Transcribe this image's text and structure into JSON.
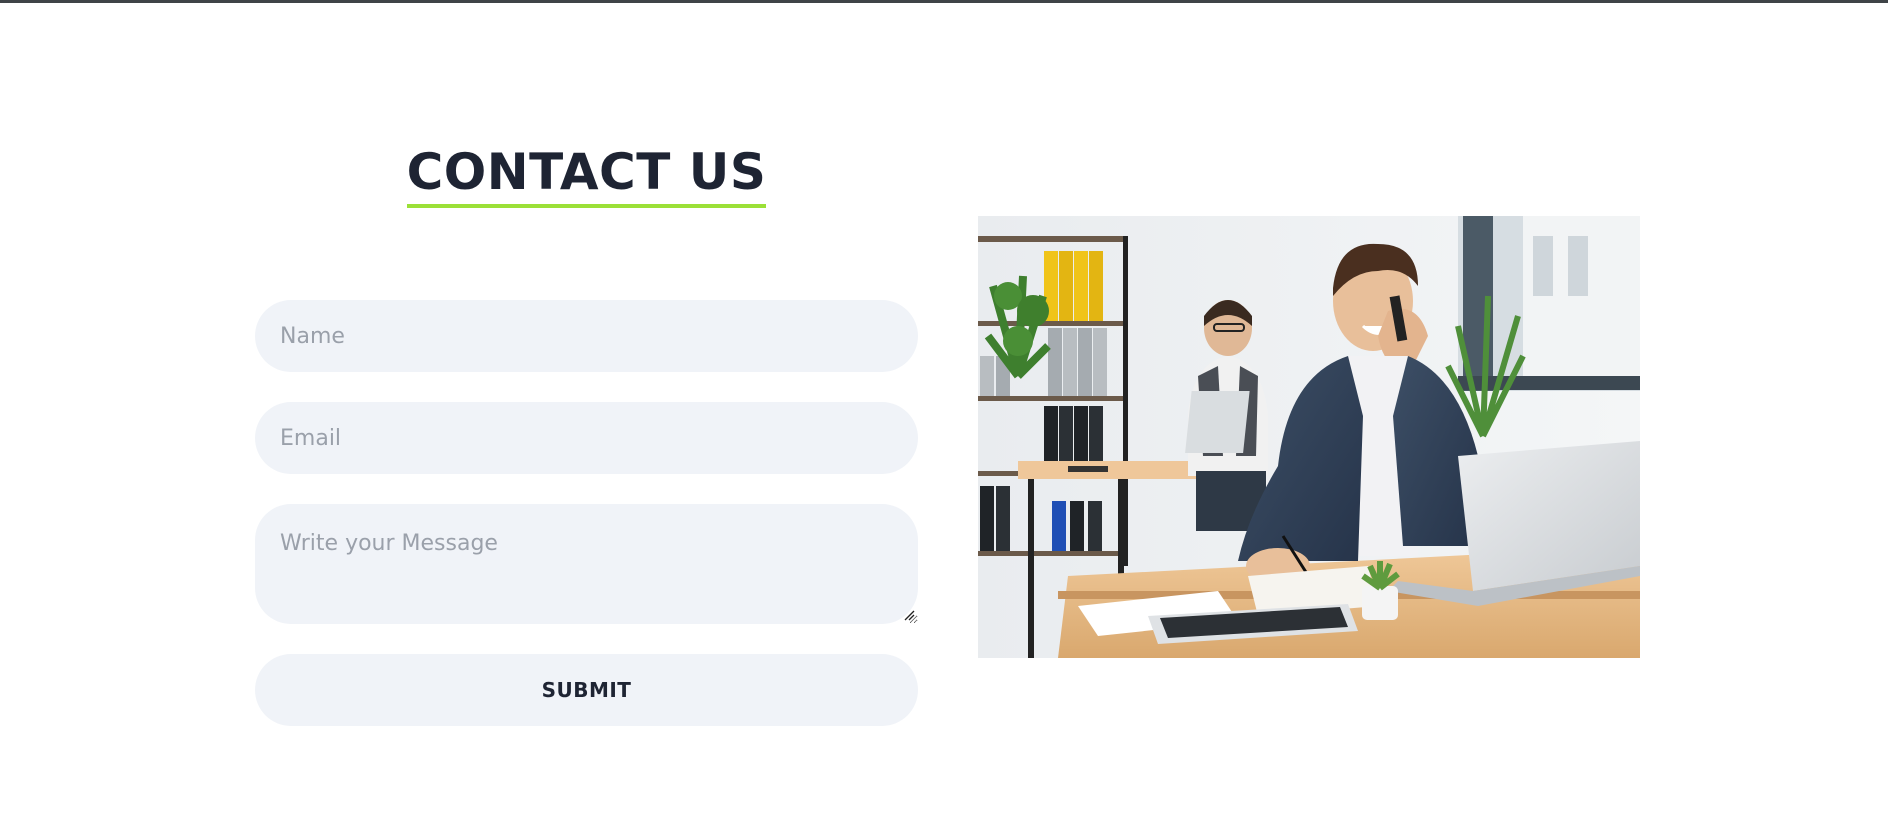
{
  "contact": {
    "heading": "CONTACT US",
    "name_placeholder": "Name",
    "email_placeholder": "Email",
    "message_placeholder": "Write your Message",
    "submit_label": "SUBMIT"
  },
  "colors": {
    "heading": "#1e2433",
    "underline_accent": "#9be037",
    "field_background": "#f0f3f8",
    "placeholder": "#9aa0aa"
  },
  "image": {
    "description_icon": "office-photo"
  }
}
